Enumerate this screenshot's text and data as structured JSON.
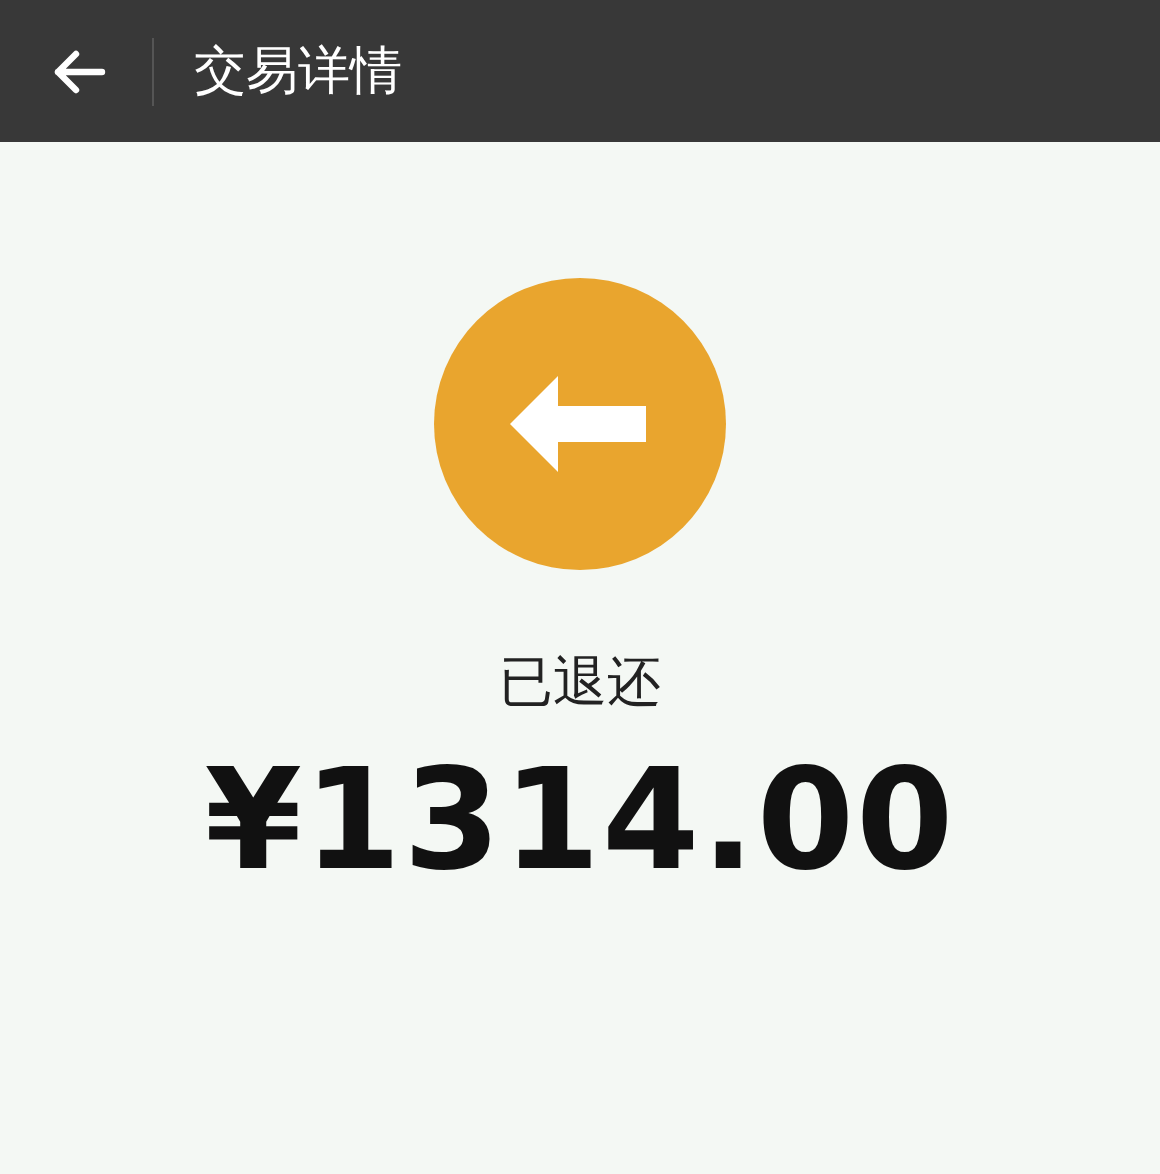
{
  "header": {
    "title": "交易详情"
  },
  "transaction": {
    "status": "已退还",
    "amount": "¥1314.00"
  }
}
